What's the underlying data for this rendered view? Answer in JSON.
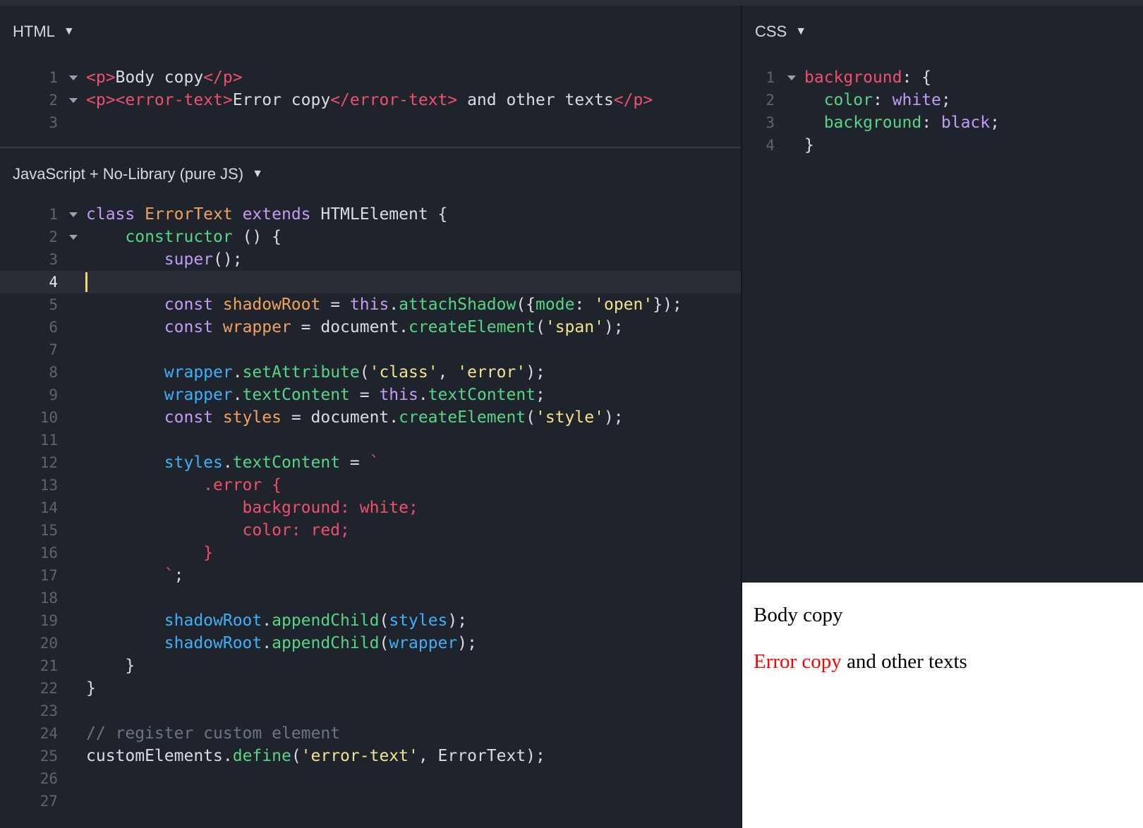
{
  "html_panel": {
    "title": "HTML",
    "caret": "▼",
    "lines": [
      {
        "n": "1",
        "fold": true,
        "tokens": [
          [
            "tag",
            "<p>"
          ],
          [
            "pl",
            "Body copy"
          ],
          [
            "tag",
            "</p>"
          ]
        ]
      },
      {
        "n": "2",
        "fold": true,
        "tokens": [
          [
            "tag",
            "<p><error-text>"
          ],
          [
            "pl",
            "Error copy"
          ],
          [
            "tag",
            "</error-text>"
          ],
          [
            "pl",
            " and other texts"
          ],
          [
            "tag",
            "</p>"
          ]
        ]
      },
      {
        "n": "3",
        "fold": false,
        "tokens": []
      }
    ]
  },
  "js_panel": {
    "title": "JavaScript + No-Library (pure JS)",
    "caret": "▼",
    "lines": [
      {
        "n": "1",
        "fold": true,
        "tokens": [
          [
            "kw",
            "class "
          ],
          [
            "cls",
            "ErrorText "
          ],
          [
            "kw",
            "extends "
          ],
          [
            "pl",
            "HTMLElement {"
          ]
        ]
      },
      {
        "n": "2",
        "fold": true,
        "tokens": [
          [
            "pl",
            "    "
          ],
          [
            "fn",
            "constructor"
          ],
          [
            "pl",
            " () {"
          ]
        ]
      },
      {
        "n": "3",
        "fold": false,
        "tokens": [
          [
            "pl",
            "        "
          ],
          [
            "kw",
            "super"
          ],
          [
            "pl",
            "();"
          ]
        ]
      },
      {
        "n": "4",
        "fold": false,
        "active": true,
        "tokens": []
      },
      {
        "n": "5",
        "fold": false,
        "tokens": [
          [
            "pl",
            "        "
          ],
          [
            "kw",
            "const "
          ],
          [
            "vdecl",
            "shadowRoot "
          ],
          [
            "pl",
            "= "
          ],
          [
            "kw",
            "this"
          ],
          [
            "pl",
            "."
          ],
          [
            "fn",
            "attachShadow"
          ],
          [
            "pl",
            "({"
          ],
          [
            "fn",
            "mode"
          ],
          [
            "pl",
            ": "
          ],
          [
            "str",
            "'open'"
          ],
          [
            "pl",
            "});"
          ]
        ]
      },
      {
        "n": "6",
        "fold": false,
        "tokens": [
          [
            "pl",
            "        "
          ],
          [
            "kw",
            "const "
          ],
          [
            "vdecl",
            "wrapper "
          ],
          [
            "pl",
            "= document."
          ],
          [
            "fn",
            "createElement"
          ],
          [
            "pl",
            "("
          ],
          [
            "str",
            "'span'"
          ],
          [
            "pl",
            ");"
          ]
        ]
      },
      {
        "n": "7",
        "fold": false,
        "tokens": []
      },
      {
        "n": "8",
        "fold": false,
        "tokens": [
          [
            "pl",
            "        "
          ],
          [
            "var",
            "wrapper"
          ],
          [
            "pl",
            "."
          ],
          [
            "fn",
            "setAttribute"
          ],
          [
            "pl",
            "("
          ],
          [
            "str",
            "'class'"
          ],
          [
            "pl",
            ", "
          ],
          [
            "str",
            "'error'"
          ],
          [
            "pl",
            ");"
          ]
        ]
      },
      {
        "n": "9",
        "fold": false,
        "tokens": [
          [
            "pl",
            "        "
          ],
          [
            "var",
            "wrapper"
          ],
          [
            "pl",
            "."
          ],
          [
            "fn",
            "textContent"
          ],
          [
            "pl",
            " = "
          ],
          [
            "kw",
            "this"
          ],
          [
            "pl",
            "."
          ],
          [
            "fn",
            "textContent"
          ],
          [
            "pl",
            ";"
          ]
        ]
      },
      {
        "n": "10",
        "fold": false,
        "tokens": [
          [
            "pl",
            "        "
          ],
          [
            "kw",
            "const "
          ],
          [
            "vdecl",
            "styles "
          ],
          [
            "pl",
            "= document."
          ],
          [
            "fn",
            "createElement"
          ],
          [
            "pl",
            "("
          ],
          [
            "str",
            "'style'"
          ],
          [
            "pl",
            ");"
          ]
        ]
      },
      {
        "n": "11",
        "fold": false,
        "tokens": []
      },
      {
        "n": "12",
        "fold": false,
        "tokens": [
          [
            "pl",
            "        "
          ],
          [
            "var",
            "styles"
          ],
          [
            "pl",
            "."
          ],
          [
            "fn",
            "textContent"
          ],
          [
            "pl",
            " = "
          ],
          [
            "css-in",
            "`"
          ]
        ]
      },
      {
        "n": "13",
        "fold": false,
        "tokens": [
          [
            "css-in",
            "            .error {"
          ]
        ]
      },
      {
        "n": "14",
        "fold": false,
        "tokens": [
          [
            "css-in",
            "                background: white;"
          ]
        ]
      },
      {
        "n": "15",
        "fold": false,
        "tokens": [
          [
            "css-in",
            "                color: red;"
          ]
        ]
      },
      {
        "n": "16",
        "fold": false,
        "tokens": [
          [
            "css-in",
            "            }"
          ]
        ]
      },
      {
        "n": "17",
        "fold": false,
        "tokens": [
          [
            "css-in",
            "        `"
          ],
          [
            "pl",
            ";"
          ]
        ]
      },
      {
        "n": "18",
        "fold": false,
        "tokens": []
      },
      {
        "n": "19",
        "fold": false,
        "tokens": [
          [
            "pl",
            "        "
          ],
          [
            "var",
            "shadowRoot"
          ],
          [
            "pl",
            "."
          ],
          [
            "fn",
            "appendChild"
          ],
          [
            "pl",
            "("
          ],
          [
            "var",
            "styles"
          ],
          [
            "pl",
            ");"
          ]
        ]
      },
      {
        "n": "20",
        "fold": false,
        "tokens": [
          [
            "pl",
            "        "
          ],
          [
            "var",
            "shadowRoot"
          ],
          [
            "pl",
            "."
          ],
          [
            "fn",
            "appendChild"
          ],
          [
            "pl",
            "("
          ],
          [
            "var",
            "wrapper"
          ],
          [
            "pl",
            ");"
          ]
        ]
      },
      {
        "n": "21",
        "fold": false,
        "tokens": [
          [
            "pl",
            "    }"
          ]
        ]
      },
      {
        "n": "22",
        "fold": false,
        "tokens": [
          [
            "pl",
            "}"
          ]
        ]
      },
      {
        "n": "23",
        "fold": false,
        "tokens": []
      },
      {
        "n": "24",
        "fold": false,
        "tokens": [
          [
            "cmt",
            "// register custom element"
          ]
        ]
      },
      {
        "n": "25",
        "fold": false,
        "tokens": [
          [
            "pl",
            "customElements."
          ],
          [
            "fn",
            "define"
          ],
          [
            "pl",
            "("
          ],
          [
            "str",
            "'error-text'"
          ],
          [
            "pl",
            ", ErrorText);"
          ]
        ]
      },
      {
        "n": "26",
        "fold": false,
        "tokens": []
      },
      {
        "n": "27",
        "fold": false,
        "tokens": []
      }
    ]
  },
  "css_panel": {
    "title": "CSS",
    "caret": "▼",
    "lines": [
      {
        "n": "1",
        "fold": true,
        "tokens": [
          [
            "tag",
            "background"
          ],
          [
            "pl",
            ": {"
          ]
        ]
      },
      {
        "n": "2",
        "fold": false,
        "tokens": [
          [
            "pl",
            "  "
          ],
          [
            "prop",
            "color"
          ],
          [
            "pl",
            ": "
          ],
          [
            "val",
            "white"
          ],
          [
            "pl",
            ";"
          ]
        ]
      },
      {
        "n": "3",
        "fold": false,
        "tokens": [
          [
            "pl",
            "  "
          ],
          [
            "prop",
            "background"
          ],
          [
            "pl",
            ": "
          ],
          [
            "val",
            "black"
          ],
          [
            "pl",
            ";"
          ]
        ]
      },
      {
        "n": "4",
        "fold": false,
        "tokens": [
          [
            "pl",
            "}"
          ]
        ]
      }
    ]
  },
  "result_panel": {
    "body_copy": "Body copy",
    "error_copy": "Error copy",
    "other_texts": " and other texts"
  }
}
